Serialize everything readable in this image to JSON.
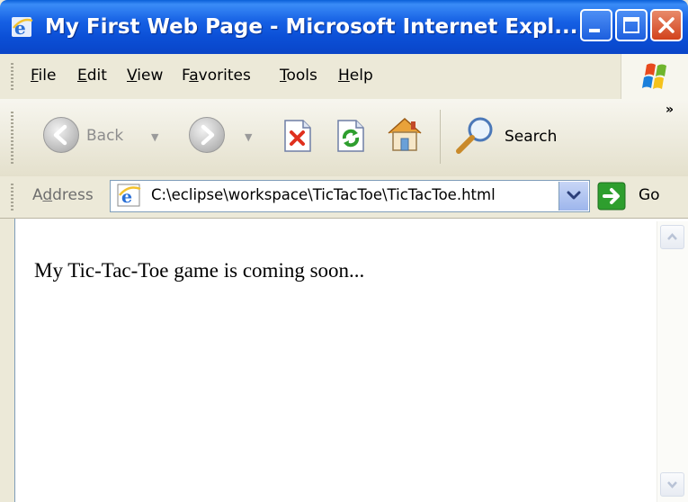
{
  "window": {
    "title": "My First Web Page - Microsoft Internet Expl...",
    "minimize_icon": "minimize-icon",
    "maximize_icon": "maximize-icon",
    "close_icon": "close-icon"
  },
  "menu": {
    "items": [
      {
        "label": "File",
        "underline": "F",
        "rest": "ile"
      },
      {
        "label": "Edit",
        "underline": "E",
        "rest": "dit"
      },
      {
        "label": "View",
        "underline": "V",
        "rest": "iew"
      },
      {
        "label": "Favorites",
        "pre": "F",
        "underline": "a",
        "rest": "vorites"
      },
      {
        "label": "Tools",
        "underline": "T",
        "rest": "ools"
      },
      {
        "label": "Help",
        "underline": "H",
        "rest": "elp"
      }
    ]
  },
  "toolbar": {
    "back_label": "Back",
    "search_label": "Search",
    "more_label": "»",
    "icons": [
      "back-arrow-icon",
      "forward-arrow-icon",
      "stop-icon",
      "refresh-icon",
      "home-icon",
      "search-icon"
    ]
  },
  "address": {
    "label_pre": "A",
    "label_underline": "d",
    "label_rest": "dress",
    "value": "C:\\eclipse\\workspace\\TicTacToe\\TicTacToe.html",
    "go_label": "Go"
  },
  "page": {
    "text": "My Tic-Tac-Toe game is coming soon..."
  },
  "colors": {
    "titlebar": "#0b4fd6",
    "chrome": "#ece9d8",
    "close_button": "#d2421c",
    "go_green": "#2e9e2e"
  }
}
